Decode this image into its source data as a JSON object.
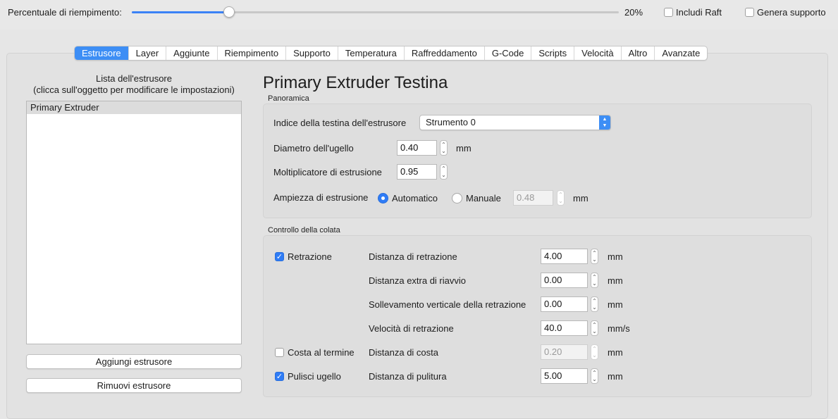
{
  "topbar": {
    "fill_label": "Percentuale di riempimento:",
    "fill_value_text": "20%",
    "fill_fraction": 0.2,
    "raft_label": "Includi Raft",
    "support_label": "Genera supporto"
  },
  "tabs": [
    {
      "label": "Estrusore"
    },
    {
      "label": "Layer"
    },
    {
      "label": "Aggiunte"
    },
    {
      "label": "Riempimento"
    },
    {
      "label": "Supporto"
    },
    {
      "label": "Temperatura"
    },
    {
      "label": "Raffreddamento"
    },
    {
      "label": "G-Code"
    },
    {
      "label": "Scripts"
    },
    {
      "label": "Velocità"
    },
    {
      "label": "Altro"
    },
    {
      "label": "Avanzate"
    }
  ],
  "left": {
    "list_title_1": "Lista dell'estrusore",
    "list_title_2": "(clicca sull'oggetto per modificare le impostazioni)",
    "items": [
      "Primary Extruder"
    ],
    "add_button": "Aggiungi estrusore",
    "remove_button": "Rimuovi estrusore"
  },
  "main": {
    "heading": "Primary Extruder Testina",
    "overview": {
      "title": "Panoramica",
      "head_index_label": "Indice della testina dell'estrusore",
      "head_index_value": "Strumento 0",
      "nozzle_label": "Diametro dell'ugello",
      "nozzle_value": "0.40",
      "nozzle_unit": "mm",
      "multiplier_label": "Moltiplicatore di estrusione",
      "multiplier_value": "0.95",
      "width_label": "Ampiezza di estrusione",
      "auto_label": "Automatico",
      "manual_label": "Manuale",
      "width_value": "0.48",
      "width_unit": "mm"
    },
    "ooze": {
      "title": "Controllo della colata",
      "retraction_label": "Retrazione",
      "coast_label": "Costa al termine",
      "wipe_label": "Pulisci ugello",
      "rows": [
        {
          "label": "Distanza di retrazione",
          "value": "4.00",
          "unit": "mm"
        },
        {
          "label": "Distanza extra di riavvio",
          "value": "0.00",
          "unit": "mm"
        },
        {
          "label": "Sollevamento verticale della retrazione",
          "value": "0.00",
          "unit": "mm"
        },
        {
          "label": "Velocità di retrazione",
          "value": "40.0",
          "unit": "mm/s"
        },
        {
          "label": "Distanza di costa",
          "value": "0.20",
          "unit": "mm"
        },
        {
          "label": "Distanza di pulitura",
          "value": "5.00",
          "unit": "mm"
        }
      ]
    }
  }
}
